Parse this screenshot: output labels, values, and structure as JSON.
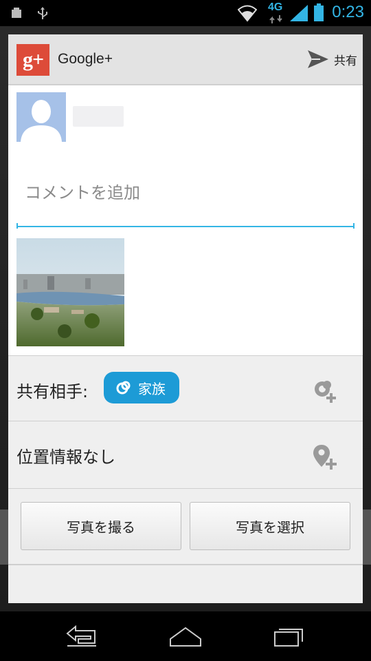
{
  "status_bar": {
    "network": "4G",
    "time": "0:23",
    "icons": [
      "notification-icon",
      "usb-icon",
      "wifi-icon",
      "signal-icon",
      "battery-icon"
    ]
  },
  "header": {
    "app_name": "Google+",
    "share_label": "共有"
  },
  "compose": {
    "comment_placeholder": "コメントを追加",
    "comment_value": ""
  },
  "audience": {
    "label": "共有相手:",
    "circle_chip": "家族"
  },
  "location": {
    "label": "位置情報なし"
  },
  "buttons": {
    "take_photo": "写真を撮る",
    "choose_photo": "写真を選択"
  },
  "colors": {
    "accent": "#33b5e5",
    "chip": "#1d9bd6",
    "gplus_red": "#dd4b39"
  }
}
